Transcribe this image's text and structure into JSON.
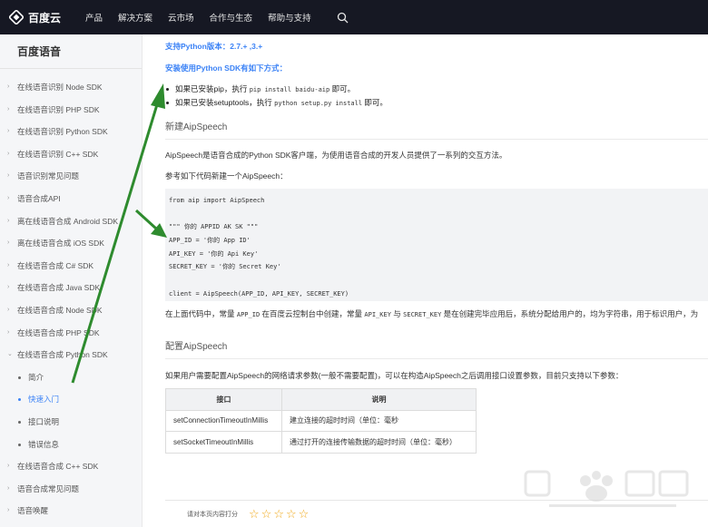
{
  "nav": {
    "logo": "百度云",
    "items": [
      "产品",
      "解决方案",
      "云市场",
      "合作与生态",
      "帮助与支持"
    ]
  },
  "sidebar": {
    "title": "百度语音",
    "items": [
      {
        "label": "在线语音识别 Node SDK",
        "caret": "›"
      },
      {
        "label": "在线语音识别 PHP SDK",
        "caret": "›"
      },
      {
        "label": "在线语音识别 Python SDK",
        "caret": "›"
      },
      {
        "label": "在线语音识别 C++ SDK",
        "caret": "›"
      },
      {
        "label": "语音识别常见问题",
        "caret": "›"
      },
      {
        "label": "语音合成API",
        "caret": "›"
      },
      {
        "label": "离在线语音合成 Android SDK",
        "caret": "›"
      },
      {
        "label": "离在线语音合成 iOS SDK",
        "caret": "›"
      },
      {
        "label": "在线语音合成 C# SDK",
        "caret": "›"
      },
      {
        "label": "在线语音合成 Java SDK",
        "caret": "›"
      },
      {
        "label": "在线语音合成 Node SDK",
        "caret": "›"
      },
      {
        "label": "在线语音合成 PHP SDK",
        "caret": "›"
      },
      {
        "label": "在线语音合成 Python SDK",
        "caret": "⌄"
      },
      {
        "label": "简介",
        "sub": true
      },
      {
        "label": "快速入门",
        "sub": true,
        "active": true
      },
      {
        "label": "接口说明",
        "sub": true
      },
      {
        "label": "错误信息",
        "sub": true
      },
      {
        "label": "在线语音合成 C++ SDK",
        "caret": "›"
      },
      {
        "label": "语音合成常见问题",
        "caret": "›"
      },
      {
        "label": "语音唤醒",
        "caret": "›"
      }
    ]
  },
  "content": {
    "python_version": "支持Python版本：2.7.+ ,3.+",
    "install_title": "安装使用Python SDK有如下方式：",
    "bullets": [
      {
        "pre": "如果已安装pip，执行 ",
        "code": "pip install baidu-aip",
        "post": " 即可。"
      },
      {
        "pre": "如果已安装setuptools，执行 ",
        "code": "python setup.py install",
        "post": " 即可。"
      }
    ],
    "section1": "新建AipSpeech",
    "intro": "AipSpeech是语音合成的Python SDK客户端，为使用语音合成的开发人员提供了一系列的交互方法。",
    "refer": "参考如下代码新建一个AipSpeech：",
    "code": [
      "from aip import AipSpeech",
      "",
      "\"\"\" 你的 APPID AK SK \"\"\"",
      "APP_ID = '你的 App ID'",
      "API_KEY = '你的 Api Key'",
      "SECRET_KEY = '你的 Secret Key'",
      "",
      "client = AipSpeech(APP_ID, API_KEY, SECRET_KEY)"
    ],
    "explain": {
      "p1": "在上面代码中，常量 ",
      "c1": "APP_ID",
      "p2": " 在百度云控制台中创建，常量 ",
      "c2": "API_KEY",
      "p3": " 与 ",
      "c3": "SECRET_KEY",
      "p4": " 是在创建完毕应用后，系统分配给用户的，均为字符串，用于标识用户，为"
    },
    "section2": "配置AipSpeech",
    "config_intro": "如果用户需要配置AipSpeech的网络请求参数(一般不需要配置)，可以在构造AipSpeech之后调用接口设置参数，目前只支持以下参数：",
    "table": {
      "headers": [
        "接口",
        "说明"
      ],
      "rows": [
        [
          "setConnectionTimeoutInMillis",
          "建立连接的超时时间（单位：毫秒"
        ],
        [
          "setSocketTimeoutInMillis",
          "通过打开的连接传输数据的超时时间（单位：毫秒）"
        ]
      ]
    },
    "rating_label": "请对本页内容打分",
    "stars": [
      "☆",
      "☆",
      "☆",
      "☆",
      "☆"
    ]
  },
  "colors": {
    "nav_bg": "#161823",
    "link_blue": "#3b82f6",
    "arrow_green": "#2e8b2e",
    "star": "#f0a818"
  }
}
